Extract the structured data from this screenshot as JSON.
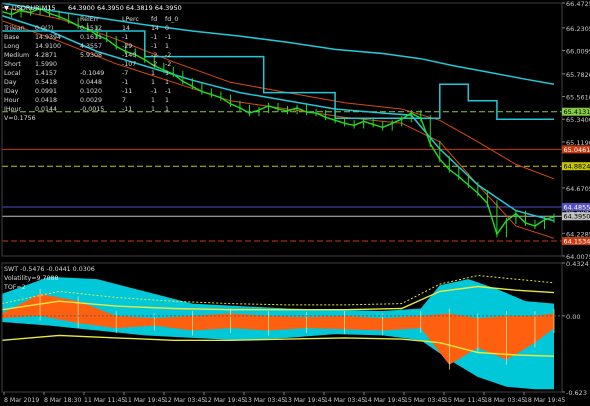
{
  "window": {
    "symbol_label": "USDRUR,M15",
    "ohlc_text": "64.3900 64.3950 64.3819 64.3950"
  },
  "colors": {
    "background": "#000000",
    "price": "#22dd22",
    "cyan_lines": "#22c8d8",
    "orange_lines": "#d84a10",
    "red_level": "#c83a10",
    "yellow_level": "#c8c800",
    "blue_level": "#5050c0",
    "dashed_green": "#88cc44",
    "swt_cyan": "#00c8d8",
    "swt_orange": "#ff6010",
    "swt_yellow": "#e8e840"
  },
  "info_table": {
    "headers": [
      "",
      "",
      "RelErr",
      "LPerc",
      "fd",
      "fd_0"
    ],
    "rows": [
      [
        "Trilean",
        "0.0(?)",
        "0.1512",
        "14",
        "14",
        "0"
      ],
      [
        "Base",
        "14.9394",
        "0.1611",
        "-1",
        "-1",
        "-1"
      ],
      [
        "Long",
        "14.9100",
        "4.3557",
        "-29",
        "-1",
        "1"
      ],
      [
        "Medium",
        "4.2871",
        "5.9308",
        "-140",
        "-2",
        "-2"
      ],
      [
        "Short",
        "1.5990",
        "",
        "-107",
        "-2",
        "-2"
      ],
      [
        "Local",
        "1.4157",
        "-0.1049",
        "-7",
        "1",
        "1"
      ],
      [
        "Day",
        "0.5418",
        "0.0448",
        "-1",
        "1",
        "1"
      ],
      [
        "IDay",
        "0.0991",
        "0.1020",
        "-11",
        "-1",
        "-1"
      ],
      [
        "Hour",
        "0.0418",
        "0.0029",
        "7",
        "1",
        "1"
      ],
      [
        "IHour",
        "0.0144",
        "-0.0015",
        "-11",
        "1",
        "1"
      ]
    ],
    "footer": "V=0.1756"
  },
  "chart_data": [
    {
      "type": "line",
      "name_label": "USDRUR,M15",
      "y_axis_ticks": [
        "66.4725",
        "66.2305",
        "66.0095",
        "65.7820",
        "65.5610",
        "65.3400",
        "65.1190",
        "64.8980",
        "64.6705",
        "64.4495",
        "64.2285",
        "64.0075"
      ],
      "ylim": [
        64.0075,
        66.4725
      ],
      "price_labels": [
        {
          "value": 65.4131,
          "text": "65.4131",
          "color": "#88cc44"
        },
        {
          "value": 65.0461,
          "text": "65.0461",
          "color": "#c83a10"
        },
        {
          "value": 64.8824,
          "text": "64.8824",
          "color": "#c8c800"
        },
        {
          "value": 64.4855,
          "text": "64.4855",
          "color": "#5050c0"
        },
        {
          "value": 64.395,
          "text": "64.3950",
          "color": "#c0c0c0"
        },
        {
          "value": 64.1534,
          "text": "64.1534",
          "color": "#c83a10"
        }
      ],
      "price": [
        [
          0,
          66.39
        ],
        [
          2,
          66.36
        ],
        [
          4,
          66.4
        ],
        [
          6,
          66.38
        ],
        [
          8,
          66.42
        ],
        [
          10,
          66.37
        ],
        [
          12,
          66.34
        ],
        [
          14,
          66.3
        ],
        [
          16,
          66.25
        ],
        [
          18,
          66.22
        ],
        [
          20,
          66.16
        ],
        [
          22,
          66.12
        ],
        [
          24,
          66.05
        ],
        [
          26,
          66.0
        ],
        [
          28,
          65.97
        ],
        [
          30,
          65.92
        ],
        [
          32,
          65.86
        ],
        [
          34,
          65.82
        ],
        [
          36,
          65.78
        ],
        [
          38,
          65.71
        ],
        [
          40,
          65.66
        ],
        [
          42,
          65.61
        ],
        [
          44,
          65.58
        ],
        [
          46,
          65.55
        ],
        [
          48,
          65.49
        ],
        [
          50,
          65.45
        ],
        [
          52,
          65.4
        ],
        [
          54,
          65.43
        ],
        [
          56,
          65.47
        ],
        [
          58,
          65.44
        ],
        [
          60,
          65.42
        ],
        [
          62,
          65.45
        ],
        [
          64,
          65.41
        ],
        [
          66,
          65.4
        ],
        [
          68,
          65.36
        ],
        [
          70,
          65.33
        ],
        [
          72,
          65.3
        ],
        [
          74,
          65.28
        ],
        [
          76,
          65.32
        ],
        [
          78,
          65.29
        ],
        [
          80,
          65.26
        ],
        [
          82,
          65.3
        ],
        [
          84,
          65.34
        ],
        [
          86,
          65.4
        ],
        [
          88,
          65.35
        ],
        [
          90,
          65.1
        ],
        [
          92,
          64.95
        ],
        [
          94,
          64.85
        ],
        [
          96,
          64.78
        ],
        [
          98,
          64.7
        ],
        [
          100,
          64.62
        ],
        [
          102,
          64.52
        ],
        [
          104,
          64.22
        ],
        [
          106,
          64.35
        ],
        [
          108,
          64.42
        ],
        [
          110,
          64.33
        ],
        [
          112,
          64.3
        ],
        [
          114,
          64.36
        ],
        [
          116,
          64.39
        ]
      ],
      "cyan_upper": [
        [
          0,
          66.47
        ],
        [
          10,
          66.4
        ],
        [
          20,
          66.33
        ],
        [
          30,
          66.26
        ],
        [
          40,
          66.2
        ],
        [
          50,
          66.15
        ],
        [
          60,
          66.09
        ],
        [
          70,
          66.02
        ],
        [
          80,
          65.98
        ],
        [
          88,
          65.93
        ],
        [
          95,
          65.86
        ],
        [
          102,
          65.8
        ],
        [
          110,
          65.73
        ],
        [
          116,
          65.68
        ]
      ],
      "cyan_lower": [
        [
          0,
          66.35
        ],
        [
          10,
          66.2
        ],
        [
          20,
          66.0
        ],
        [
          30,
          65.86
        ],
        [
          40,
          65.72
        ],
        [
          50,
          65.6
        ],
        [
          60,
          65.52
        ],
        [
          70,
          65.44
        ],
        [
          80,
          65.4
        ],
        [
          86,
          65.38
        ],
        [
          92,
          65.05
        ],
        [
          100,
          64.7
        ],
        [
          108,
          64.45
        ],
        [
          116,
          64.35
        ]
      ],
      "cyan_step": [
        [
          0,
          66.2
        ],
        [
          30,
          66.2
        ],
        [
          30,
          65.95
        ],
        [
          55,
          65.95
        ],
        [
          55,
          65.6
        ],
        [
          70,
          65.6
        ],
        [
          70,
          65.35
        ],
        [
          92,
          65.35
        ],
        [
          92,
          65.68
        ],
        [
          98,
          65.68
        ],
        [
          98,
          65.52
        ],
        [
          104,
          65.52
        ],
        [
          104,
          65.34
        ],
        [
          116,
          65.34
        ]
      ],
      "orange_upper": [
        [
          0,
          66.43
        ],
        [
          12,
          66.32
        ],
        [
          24,
          66.12
        ],
        [
          36,
          65.9
        ],
        [
          48,
          65.7
        ],
        [
          60,
          65.6
        ],
        [
          72,
          65.5
        ],
        [
          84,
          65.44
        ],
        [
          92,
          65.33
        ],
        [
          100,
          65.12
        ],
        [
          108,
          64.9
        ],
        [
          116,
          64.76
        ]
      ],
      "orange_lower": [
        [
          0,
          66.3
        ],
        [
          12,
          66.1
        ],
        [
          24,
          65.88
        ],
        [
          36,
          65.7
        ],
        [
          48,
          65.52
        ],
        [
          60,
          65.44
        ],
        [
          72,
          65.36
        ],
        [
          84,
          65.3
        ],
        [
          92,
          65.12
        ],
        [
          100,
          64.7
        ],
        [
          108,
          64.3
        ],
        [
          116,
          64.18
        ]
      ],
      "xlim": [
        0,
        116
      ]
    },
    {
      "type": "area",
      "label": "SWT -0.5476 -0.0441 0.0306",
      "extra_labels": [
        "Volatility=9.7088",
        "TOF=2"
      ],
      "y_axis_ticks": [
        "0.4324",
        "0.00",
        "-0.623"
      ],
      "ylim": [
        -0.623,
        0.4324
      ],
      "x_tick_labels": [
        "8 Mar 2019",
        "8 Mar 18:30",
        "11 Mar 11:45",
        "11 Mar 19:45",
        "12 Mar 03:45",
        "12 Mar 19:45",
        "13 Mar 03:45",
        "13 Mar 19:45",
        "14 Mar 03:45",
        "14 Mar 19:45",
        "15 Mar 03:45",
        "15 Mar 11:45",
        "18 Mar 03:45",
        "18 Mar 19:45"
      ],
      "cyan_band_top": [
        [
          0,
          0.18
        ],
        [
          10,
          0.32
        ],
        [
          20,
          0.3
        ],
        [
          30,
          0.2
        ],
        [
          40,
          0.1
        ],
        [
          50,
          0.08
        ],
        [
          60,
          0.06
        ],
        [
          70,
          0.05
        ],
        [
          80,
          0.04
        ],
        [
          88,
          0.06
        ],
        [
          92,
          0.25
        ],
        [
          98,
          0.3
        ],
        [
          104,
          0.22
        ],
        [
          110,
          0.12
        ],
        [
          116,
          0.1
        ]
      ],
      "cyan_band_bottom": [
        [
          0,
          -0.05
        ],
        [
          10,
          -0.08
        ],
        [
          20,
          -0.12
        ],
        [
          30,
          -0.16
        ],
        [
          40,
          -0.18
        ],
        [
          50,
          -0.2
        ],
        [
          60,
          -0.18
        ],
        [
          70,
          -0.15
        ],
        [
          80,
          -0.16
        ],
        [
          88,
          -0.2
        ],
        [
          94,
          -0.36
        ],
        [
          100,
          -0.5
        ],
        [
          106,
          -0.58
        ],
        [
          112,
          -0.6
        ],
        [
          116,
          -0.6
        ]
      ],
      "orange_band": [
        [
          0,
          0.02,
          -0.02
        ],
        [
          8,
          0.18,
          0.0
        ],
        [
          16,
          0.12,
          -0.06
        ],
        [
          24,
          0.0,
          -0.1
        ],
        [
          32,
          -0.02,
          -0.08
        ],
        [
          40,
          0.0,
          -0.12
        ],
        [
          48,
          0.02,
          -0.1
        ],
        [
          56,
          0.0,
          -0.12
        ],
        [
          64,
          -0.01,
          -0.1
        ],
        [
          72,
          0.0,
          -0.11
        ],
        [
          80,
          -0.02,
          -0.12
        ],
        [
          88,
          0.0,
          -0.1
        ],
        [
          94,
          0.02,
          -0.4
        ],
        [
          100,
          -0.02,
          -0.26
        ],
        [
          106,
          0.0,
          -0.36
        ],
        [
          112,
          0.0,
          -0.22
        ],
        [
          116,
          0.02,
          -0.1
        ]
      ],
      "yellow_upper": [
        [
          0,
          0.1
        ],
        [
          12,
          0.2
        ],
        [
          24,
          0.15
        ],
        [
          36,
          0.12
        ],
        [
          48,
          0.1
        ],
        [
          60,
          0.09
        ],
        [
          72,
          0.09
        ],
        [
          84,
          0.1
        ],
        [
          92,
          0.26
        ],
        [
          100,
          0.33
        ],
        [
          108,
          0.3
        ],
        [
          116,
          0.27
        ]
      ],
      "yellow_mid": [
        [
          0,
          0.05
        ],
        [
          12,
          0.12
        ],
        [
          24,
          0.08
        ],
        [
          36,
          0.06
        ],
        [
          48,
          0.05
        ],
        [
          60,
          0.05
        ],
        [
          72,
          0.05
        ],
        [
          84,
          0.06
        ],
        [
          92,
          0.2
        ],
        [
          100,
          0.24
        ],
        [
          108,
          0.21
        ],
        [
          116,
          0.19
        ]
      ],
      "yellow_lower": [
        [
          0,
          -0.2
        ],
        [
          12,
          -0.16
        ],
        [
          24,
          -0.18
        ],
        [
          36,
          -0.2
        ],
        [
          48,
          -0.2
        ],
        [
          60,
          -0.19
        ],
        [
          72,
          -0.18
        ],
        [
          84,
          -0.19
        ],
        [
          92,
          -0.22
        ],
        [
          100,
          -0.3
        ],
        [
          108,
          -0.32
        ],
        [
          116,
          -0.33
        ]
      ],
      "xlim": [
        0,
        116
      ]
    }
  ]
}
